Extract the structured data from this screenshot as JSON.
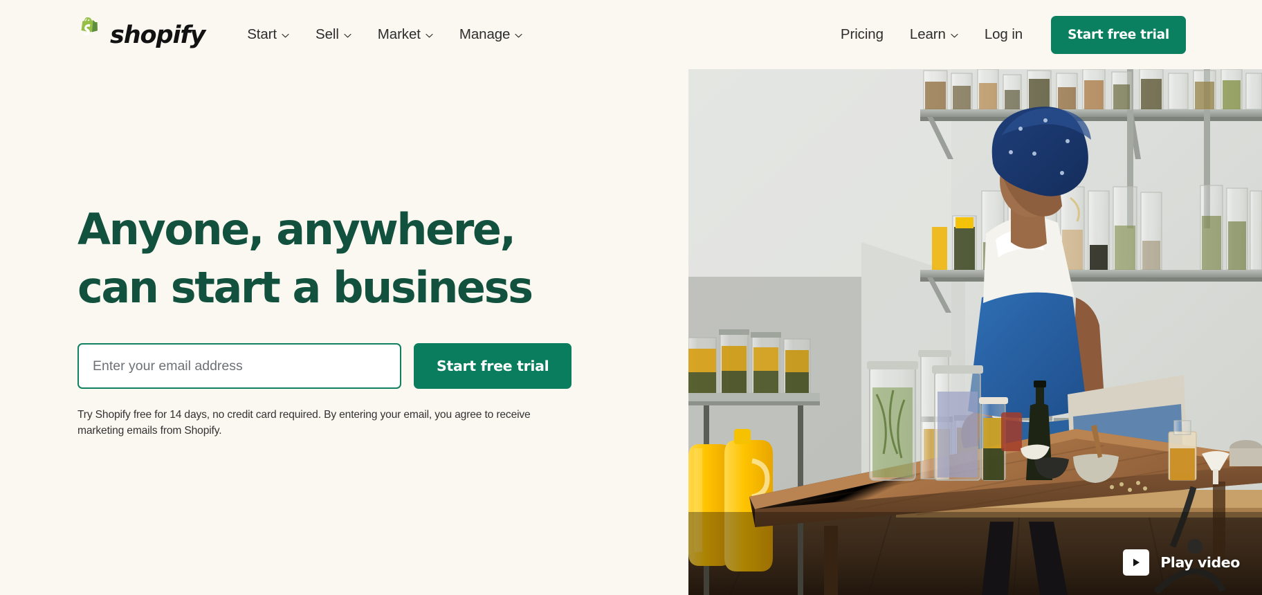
{
  "brand": {
    "name": "shopify",
    "logo_icon": "shopify-bag-icon",
    "bag_color": "#95BF47",
    "bag_dark": "#5E8E3E",
    "wordmark_color": "#121212"
  },
  "colors": {
    "background": "#FAF8F0",
    "primary_green": "#0A8060",
    "heading_green": "#13513F",
    "text_dark": "#2D2D2D",
    "placeholder_gray": "#6D7175",
    "white": "#FFFFFF"
  },
  "nav": {
    "primary_items": [
      {
        "label": "Start",
        "has_dropdown": true,
        "icon": "chevron-down-icon"
      },
      {
        "label": "Sell",
        "has_dropdown": true,
        "icon": "chevron-down-icon"
      },
      {
        "label": "Market",
        "has_dropdown": true,
        "icon": "chevron-down-icon"
      },
      {
        "label": "Manage",
        "has_dropdown": true,
        "icon": "chevron-down-icon"
      }
    ],
    "secondary_items": [
      {
        "label": "Pricing",
        "has_dropdown": false
      },
      {
        "label": "Learn",
        "has_dropdown": true,
        "icon": "chevron-down-icon"
      },
      {
        "label": "Log in",
        "has_dropdown": false
      }
    ],
    "cta_label": "Start free trial"
  },
  "hero": {
    "title": "Anyone, anywhere, can start a business",
    "email_placeholder": "Enter your email address",
    "email_value": "",
    "cta_label": "Start free trial",
    "fineprint": "Try Shopify free for 14 days, no credit card required. By entering your email, you agree to receive marketing emails from Shopify."
  },
  "media": {
    "play_label": "Play video",
    "play_icon": "play-triangle-icon",
    "alt": "Woman in blue headwrap and denim overalls working at a laptop on a wooden table surrounded by shelves of glass jars"
  }
}
